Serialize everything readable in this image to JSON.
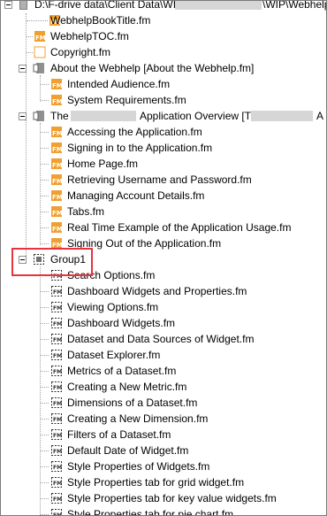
{
  "tree": {
    "root": {
      "label_start": "D:\\F-drive data\\Client Data\\WIP\\",
      "label_end": "\\WIP\\Webhelp\\Web"
    },
    "top_files": [
      {
        "label": "WebhelpBookTitle.fm",
        "icon": "fm-file-icon"
      },
      {
        "label": "WebhelpTOC.fm",
        "icon": "fm-file-icon"
      },
      {
        "label": "Copyright.fm",
        "icon": "fm-file-icon"
      }
    ],
    "about_group": {
      "label": "About the Webhelp [About the Webhelp.fm]",
      "icon": "book-group-icon",
      "children": [
        {
          "label": "Intended Audience.fm",
          "icon": "fm-file-icon"
        },
        {
          "label": "System Requirements.fm",
          "icon": "fm-file-icon"
        }
      ]
    },
    "overview_group": {
      "label_prefix": "The",
      "label_middle": "Application Overview [The",
      "label_end": "A",
      "icon": "book-group-icon",
      "children": [
        {
          "label": "Accessing the Application.fm",
          "icon": "fm-file-icon"
        },
        {
          "label": "Signing in to the Application.fm",
          "icon": "fm-file-icon"
        },
        {
          "label": "Home Page.fm",
          "icon": "fm-file-icon"
        },
        {
          "label": "Retrieving Username and Password.fm",
          "icon": "fm-file-icon"
        },
        {
          "label": "Managing Account Details.fm",
          "icon": "fm-file-icon"
        },
        {
          "label": "Tabs.fm",
          "icon": "fm-file-icon"
        },
        {
          "label": "Real Time Example of the Application Usage.fm",
          "icon": "fm-file-icon"
        },
        {
          "label": "Signing Out of the Application.fm",
          "icon": "fm-file-icon"
        }
      ]
    },
    "group1": {
      "label": "Group1",
      "icon": "group-dashed-icon",
      "children": [
        {
          "label": "Search Options.fm"
        },
        {
          "label": "Dashboard Widgets and Properties.fm"
        },
        {
          "label": "Viewing Options.fm"
        },
        {
          "label": "Dashboard Widgets.fm"
        },
        {
          "label": "Dataset and Data Sources of Widget.fm"
        },
        {
          "label": "Dataset Explorer.fm"
        },
        {
          "label": "Metrics of a Dataset.fm"
        },
        {
          "label": "Creating a New Metric.fm"
        },
        {
          "label": "Dimensions of a Dataset.fm"
        },
        {
          "label": "Creating a New Dimension.fm"
        },
        {
          "label": "Filters of a Dataset.fm"
        },
        {
          "label": "Default Date of Widget.fm"
        },
        {
          "label": "Style Properties of Widgets.fm"
        },
        {
          "label": "Style Properties tab for grid widget.fm"
        },
        {
          "label": "Style Properties tab for key value widgets.fm"
        },
        {
          "label": "Style Properties tab for pie chart.fm"
        }
      ]
    }
  },
  "colors": {
    "fm_icon_orange": "#f0a030",
    "highlight_red": "#e8323c",
    "tree_lines": "#a0a0a0"
  }
}
